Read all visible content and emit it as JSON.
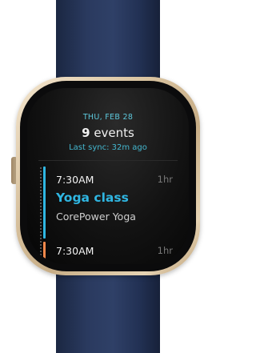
{
  "calendar": {
    "date": "THU, FEB 28",
    "event_count": "9",
    "event_count_label": " events",
    "last_sync": "Last sync: 32m ago"
  },
  "events": [
    {
      "time": "7:30AM",
      "duration": "1hr",
      "title": "Yoga class",
      "location": "CorePower Yoga",
      "color": "#2fb6e2"
    },
    {
      "time": "7:30AM",
      "duration": "1hr",
      "color": "#f5884b"
    }
  ],
  "colors": {
    "accent": "#5dc8dc",
    "strap": "#2a3a5f",
    "case": "#d9c3a0",
    "screen": "#0b0b0c"
  }
}
